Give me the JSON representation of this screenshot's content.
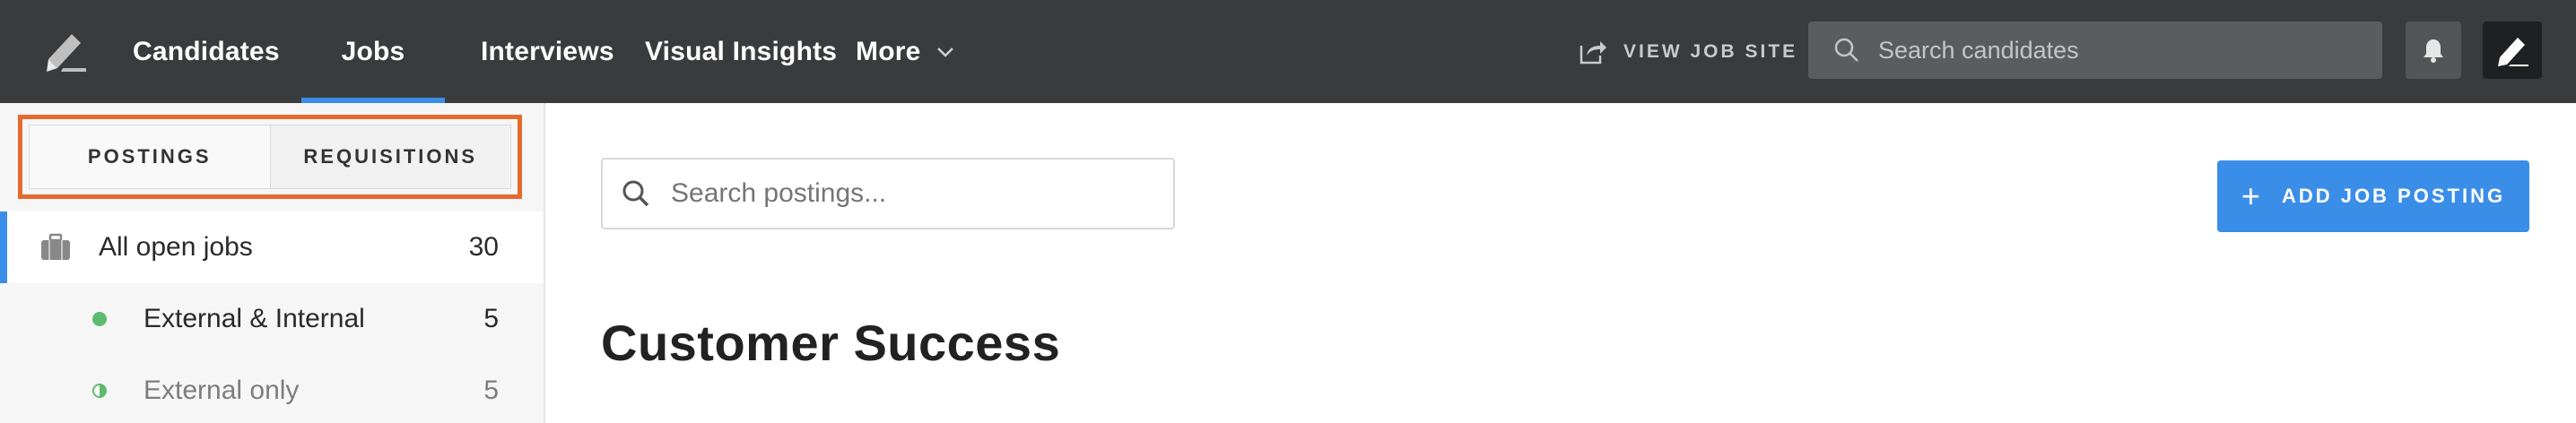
{
  "topbar": {
    "nav": [
      {
        "label": "Candidates",
        "active": false
      },
      {
        "label": "Jobs",
        "active": true
      },
      {
        "label": "Interviews",
        "active": false
      },
      {
        "label": "Visual Insights",
        "active": false
      },
      {
        "label": "More",
        "active": false
      }
    ],
    "view_job_site": "VIEW JOB SITE",
    "search_placeholder": "Search candidates",
    "colors": {
      "background": "#3a3b3d",
      "active_underline": "#3b8ee8"
    },
    "icons": [
      "logo-icon",
      "chevron-down-icon",
      "share-icon",
      "search-icon",
      "bell-icon",
      "avatar-icon"
    ]
  },
  "sidebar": {
    "tabs": [
      {
        "label": "POSTINGS",
        "selected": true
      },
      {
        "label": "REQUISITIONS",
        "selected": false
      }
    ],
    "highlight_color": "#e26c2e",
    "items": [
      {
        "label": "All open jobs",
        "count": "30",
        "icon": "briefcase-icon",
        "active": true
      },
      {
        "label": "External & Internal",
        "count": "5",
        "icon": "green-dot-icon",
        "active": false
      },
      {
        "label": "External only",
        "count": "5",
        "icon": "half-green-dot-icon",
        "active": false
      }
    ]
  },
  "main": {
    "search_placeholder": "Search postings...",
    "add_button_label": "ADD JOB POSTING",
    "section_title": "Customer Success",
    "accent_color": "#3b8ee8"
  }
}
